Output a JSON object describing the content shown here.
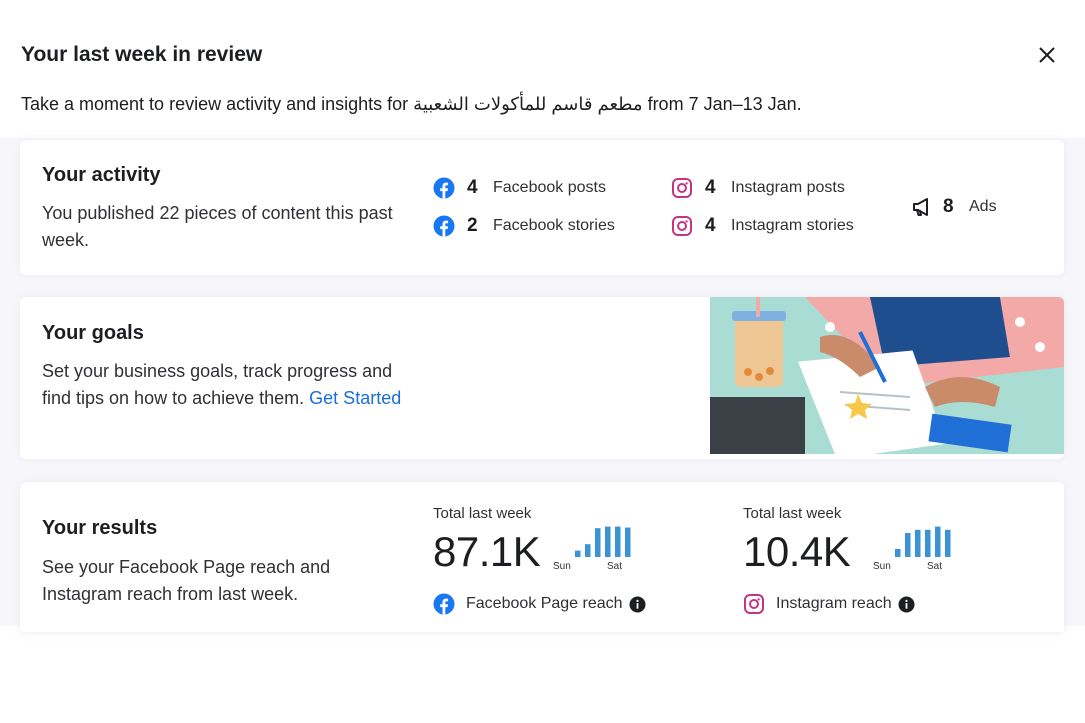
{
  "dialog": {
    "title": "Your last week in review",
    "subtitle": "Take a moment to review activity and insights for مطعم قاسم للمأكولات الشعبية from 7 Jan–13 Jan."
  },
  "activity": {
    "title": "Your activity",
    "text": "You published 22 pieces of content this past week.",
    "stats": [
      {
        "icon": "facebook-icon",
        "count": "4",
        "label": "Facebook posts"
      },
      {
        "icon": "facebook-icon",
        "count": "2",
        "label": "Facebook stories"
      },
      {
        "icon": "instagram-icon",
        "count": "4",
        "label": "Instagram posts"
      },
      {
        "icon": "instagram-icon",
        "count": "4",
        "label": "Instagram stories"
      },
      {
        "icon": "megaphone-icon",
        "count": "8",
        "label": "Ads"
      }
    ]
  },
  "goals": {
    "title": "Your goals",
    "text": "Set your business goals, track progress and find tips on how to achieve them.",
    "link": "Get Started"
  },
  "results": {
    "title": "Your results",
    "text": "See your Facebook Page reach and Instagram reach from last week.",
    "facebook": {
      "total_label": "Total last week",
      "value": "87.1K",
      "spark_start": "Sun",
      "spark_end": "Sat",
      "spark_values": [
        0.2,
        0.4,
        0.9,
        0.95,
        0.95,
        0.92,
        0.55
      ],
      "label": "Facebook Page reach"
    },
    "instagram": {
      "total_label": "Total last week",
      "value": "10.4K",
      "spark_start": "Sun",
      "spark_end": "Sat",
      "spark_values": [
        0.25,
        0.75,
        0.85,
        0.85,
        0.95,
        0.85,
        0.8
      ],
      "label": "Instagram reach"
    }
  },
  "colors": {
    "facebook": "#1877f2",
    "instagram": "#c13584",
    "link": "#1a6ed8",
    "spark": "#3b93d6"
  }
}
